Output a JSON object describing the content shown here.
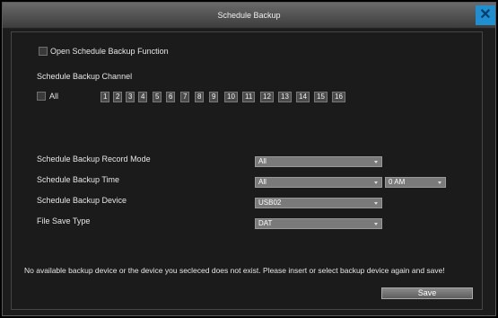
{
  "window": {
    "title": "Schedule Backup",
    "close_glyph": "✕"
  },
  "open_function": {
    "label": "Open Schedule Backup Function"
  },
  "channel": {
    "heading": "Schedule Backup Channel",
    "all_label": "All",
    "numbers": [
      "1",
      "2",
      "3",
      "4",
      "5",
      "6",
      "7",
      "8",
      "9",
      "10",
      "11",
      "12",
      "13",
      "14",
      "15",
      "16"
    ]
  },
  "fields": {
    "record_mode": {
      "label": "Schedule Backup Record Mode",
      "value": "All"
    },
    "time": {
      "label": "Schedule Backup Time",
      "value": "All",
      "hour_value": "0 AM"
    },
    "device": {
      "label": "Schedule Backup Device",
      "value": "USB02"
    },
    "file_type": {
      "label": "File Save Type",
      "value": "DAT"
    }
  },
  "message": "No available backup device or the device you secleced does not exist. Please insert or select backup device again and save!",
  "save_label": "Save",
  "colors": {
    "title_bar": "#4a4a4a",
    "close_button": "#1e8fd0",
    "background": "#1c1c1c"
  }
}
